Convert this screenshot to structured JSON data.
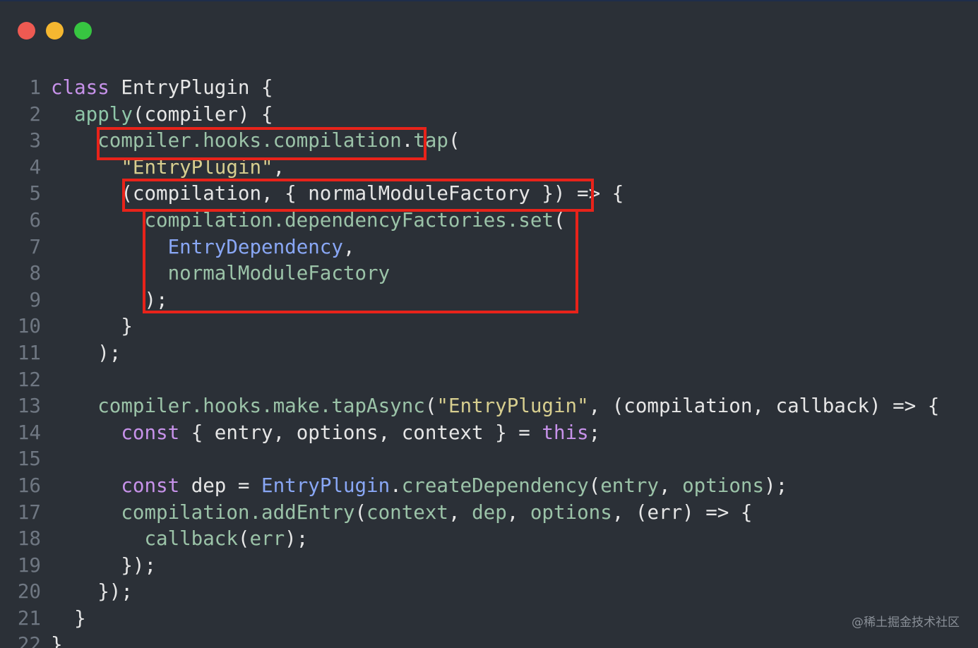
{
  "window": {
    "controls": [
      {
        "name": "close",
        "color": "#ee5a52"
      },
      {
        "name": "minimize",
        "color": "#f5b730"
      },
      {
        "name": "maximize",
        "color": "#37c541"
      }
    ]
  },
  "code_lines": [
    {
      "n": "1",
      "tokens": [
        [
          "kw",
          "class"
        ],
        [
          "pl",
          " EntryPlugin {"
        ]
      ]
    },
    {
      "n": "2",
      "tokens": [
        [
          "pl",
          "  "
        ],
        [
          "fn",
          "apply"
        ],
        [
          "pl",
          "(compiler) {"
        ]
      ]
    },
    {
      "n": "3",
      "tokens": [
        [
          "pl",
          "    "
        ],
        [
          "pr",
          "compiler.hooks.compilation"
        ],
        [
          "pl",
          "."
        ],
        [
          "pr",
          "tap"
        ],
        [
          "pl",
          "("
        ]
      ]
    },
    {
      "n": "4",
      "tokens": [
        [
          "pl",
          "      "
        ],
        [
          "st",
          "\"EntryPlugin\""
        ],
        [
          "pl",
          ","
        ]
      ]
    },
    {
      "n": "5",
      "tokens": [
        [
          "pl",
          "      (compilation, { normalModuleFactory }) => {"
        ]
      ]
    },
    {
      "n": "6",
      "tokens": [
        [
          "pl",
          "        "
        ],
        [
          "pr",
          "compilation.dependencyFactories.set"
        ],
        [
          "pl",
          "("
        ]
      ]
    },
    {
      "n": "7",
      "tokens": [
        [
          "pl",
          "          "
        ],
        [
          "ty",
          "EntryDependency"
        ],
        [
          "pl",
          ","
        ]
      ]
    },
    {
      "n": "8",
      "tokens": [
        [
          "pl",
          "          "
        ],
        [
          "pr",
          "normalModuleFactory"
        ]
      ]
    },
    {
      "n": "9",
      "tokens": [
        [
          "pl",
          "        );"
        ]
      ]
    },
    {
      "n": "10",
      "tokens": [
        [
          "pl",
          "      }"
        ]
      ]
    },
    {
      "n": "11",
      "tokens": [
        [
          "pl",
          "    );"
        ]
      ]
    },
    {
      "n": "12",
      "tokens": [
        [
          "pl",
          ""
        ]
      ]
    },
    {
      "n": "13",
      "tokens": [
        [
          "pl",
          "    "
        ],
        [
          "pr",
          "compiler.hooks.make.tapAsync"
        ],
        [
          "pl",
          "("
        ],
        [
          "st",
          "\"EntryPlugin\""
        ],
        [
          "pl",
          ", (compilation, callback) => {"
        ]
      ]
    },
    {
      "n": "14",
      "tokens": [
        [
          "pl",
          "      "
        ],
        [
          "kw",
          "const"
        ],
        [
          "pl",
          " { entry, options, context } = "
        ],
        [
          "kw",
          "this"
        ],
        [
          "pl",
          ";"
        ]
      ]
    },
    {
      "n": "15",
      "tokens": [
        [
          "pl",
          ""
        ]
      ]
    },
    {
      "n": "16",
      "tokens": [
        [
          "pl",
          "      "
        ],
        [
          "kw",
          "const"
        ],
        [
          "pl",
          " dep = "
        ],
        [
          "ty",
          "EntryPlugin"
        ],
        [
          "pl",
          "."
        ],
        [
          "pr",
          "createDependency"
        ],
        [
          "pl",
          "("
        ],
        [
          "pr",
          "entry"
        ],
        [
          "pl",
          ", "
        ],
        [
          "pr",
          "options"
        ],
        [
          "pl",
          ");"
        ]
      ]
    },
    {
      "n": "17",
      "tokens": [
        [
          "pl",
          "      "
        ],
        [
          "pr",
          "compilation.addEntry"
        ],
        [
          "pl",
          "("
        ],
        [
          "pr",
          "context"
        ],
        [
          "pl",
          ", "
        ],
        [
          "pr",
          "dep"
        ],
        [
          "pl",
          ", "
        ],
        [
          "pr",
          "options"
        ],
        [
          "pl",
          ", (err) => {"
        ]
      ]
    },
    {
      "n": "18",
      "tokens": [
        [
          "pl",
          "        "
        ],
        [
          "pr",
          "callback"
        ],
        [
          "pl",
          "("
        ],
        [
          "pr",
          "err"
        ],
        [
          "pl",
          ");"
        ]
      ]
    },
    {
      "n": "19",
      "tokens": [
        [
          "pl",
          "      });"
        ]
      ]
    },
    {
      "n": "20",
      "tokens": [
        [
          "pl",
          "    });"
        ]
      ]
    },
    {
      "n": "21",
      "tokens": [
        [
          "pl",
          "  }"
        ]
      ]
    },
    {
      "n": "22",
      "tokens": [
        [
          "pl",
          "}"
        ]
      ]
    }
  ],
  "highlight_color": "#e8231a",
  "watermark": "@稀土掘金技术社区"
}
